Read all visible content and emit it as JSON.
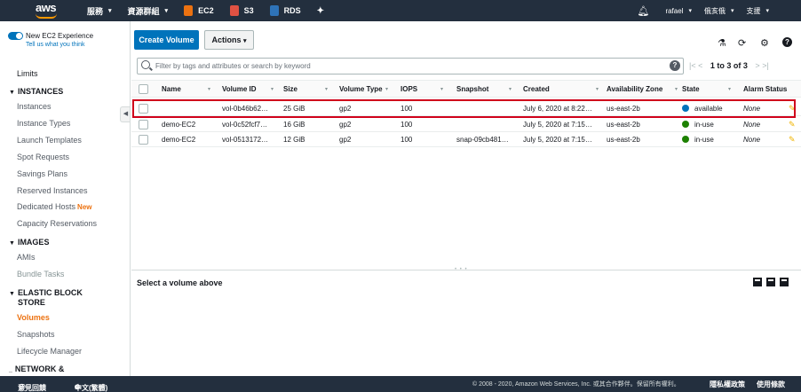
{
  "topnav": {
    "logo": "aws",
    "services": "服務",
    "resource_groups": "資源群組",
    "shortcuts": [
      {
        "label": "EC2",
        "color": "#ec7211"
      },
      {
        "label": "S3",
        "color": "#e05243"
      },
      {
        "label": "RDS",
        "color": "#2e73b8"
      }
    ],
    "pin_icon": "pin-icon",
    "bell_icon": "bell-icon",
    "user": "rafael",
    "region": "俄亥俄",
    "support": "支援"
  },
  "sidebar": {
    "new_experience": {
      "title": "New EC2 Experience",
      "link": "Tell us what you think"
    },
    "limits": "Limits",
    "instances_header": "INSTANCES",
    "instances_items": [
      "Instances",
      "Instance Types",
      "Launch Templates",
      "Spot Requests",
      "Savings Plans",
      "Reserved Instances",
      "Dedicated Hosts",
      "Capacity Reservations"
    ],
    "new_badge": "New",
    "images_header": "IMAGES",
    "images_items": [
      "AMIs",
      "Bundle Tasks"
    ],
    "ebs_header_1": "ELASTIC BLOCK",
    "ebs_header_2": "STORE",
    "ebs_items": [
      "Volumes",
      "Snapshots",
      "Lifecycle Manager"
    ],
    "network_header": "NETWORK &"
  },
  "toolbar": {
    "create_volume": "Create Volume",
    "actions": "Actions",
    "icons": [
      "flask-icon",
      "refresh-icon",
      "gear-icon",
      "help-icon"
    ]
  },
  "search": {
    "placeholder": "Filter by tags and attributes or search by keyword",
    "pager": "1 to 3 of 3"
  },
  "table": {
    "columns": [
      "Name",
      "Volume ID",
      "Size",
      "Volume Type",
      "IOPS",
      "Snapshot",
      "Created",
      "Availability Zone",
      "State",
      "Alarm Status"
    ],
    "rows": [
      {
        "name": "",
        "volume_id": "vol-0b46b62…",
        "size": "25 GiB",
        "type": "gp2",
        "iops": "100",
        "snapshot": "",
        "created": "July 6, 2020 at 8:22…",
        "az": "us-east-2b",
        "state": "available",
        "state_color": "#0073bb",
        "alarm": "None"
      },
      {
        "name": "demo-EC2",
        "volume_id": "vol-0c52fcf7…",
        "size": "16 GiB",
        "type": "gp2",
        "iops": "100",
        "snapshot": "",
        "created": "July 5, 2020 at 7:15…",
        "az": "us-east-2b",
        "state": "in-use",
        "state_color": "#1d8102",
        "alarm": "None"
      },
      {
        "name": "demo-EC2",
        "volume_id": "vol-0513172…",
        "size": "12 GiB",
        "type": "gp2",
        "iops": "100",
        "snapshot": "snap-09cb481…",
        "created": "July 5, 2020 at 7:15…",
        "az": "us-east-2b",
        "state": "in-use",
        "state_color": "#1d8102",
        "alarm": "None"
      }
    ]
  },
  "detail": {
    "title": "Select a volume above"
  },
  "footer": {
    "feedback": "意見回饋",
    "language": "中文(繁體)",
    "copyright": "© 2008 - 2020, Amazon Web Services, Inc. 或其合作夥伴。保留所有權利。",
    "privacy": "隱私權政策",
    "terms": "使用條款"
  }
}
